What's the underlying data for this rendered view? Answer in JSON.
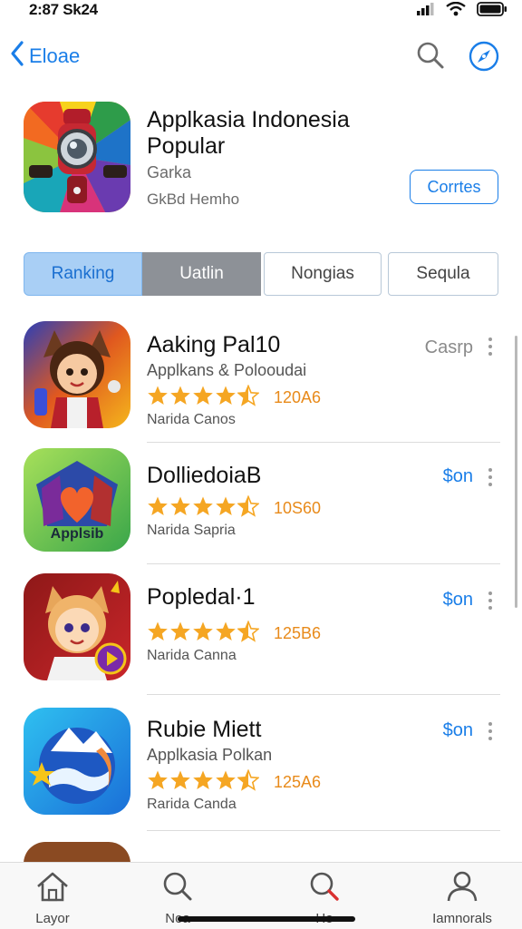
{
  "status_bar": {
    "time": "2:87 Sk24"
  },
  "nav": {
    "back_label": "Eloae"
  },
  "hero": {
    "title": "Applkasia Indonesia Popular",
    "subtitle": "Garka",
    "developer": "GkBd Hemho",
    "contact_label": "Corrtes"
  },
  "segments": [
    "Ranking",
    "Uatlin",
    "Nongias",
    "Sequla"
  ],
  "apps": [
    {
      "name": "Aaking Pal10",
      "category": "Applkans & Polooudai",
      "rating_count": "120A6",
      "developer": "Narida Canos",
      "price": "Casrp",
      "price_color": "#8a8a8a",
      "rating": 4.5
    },
    {
      "name": "DolliedoiaB",
      "category": "",
      "rating_count": "10S60",
      "developer": "Narida Sapria",
      "price": "$on",
      "price_color": "#1a7ee8",
      "rating": 4.5,
      "icon_text": "Applsib"
    },
    {
      "name": "Popledal·1",
      "category": "",
      "rating_count": "125B6",
      "developer": "Narida Canna",
      "price": "$on",
      "price_color": "#1a7ee8",
      "rating": 4.5
    },
    {
      "name": "Rubie Miett",
      "category": "Applkasia Polkan",
      "rating_count": "125A6",
      "developer": "Rarida Canda",
      "price": "$on",
      "price_color": "#1a7ee8",
      "rating": 4.5
    }
  ],
  "tab_bar": [
    {
      "label": "Layor",
      "icon": "home-icon"
    },
    {
      "label": "Noa",
      "icon": "search-icon"
    },
    {
      "label": "Ho",
      "icon": "search-icon"
    },
    {
      "label": "Iamnorals",
      "icon": "person-icon"
    }
  ],
  "colors": {
    "accent": "#1a7ee8",
    "star": "#f5a623",
    "rating_text": "#e88a1a"
  }
}
